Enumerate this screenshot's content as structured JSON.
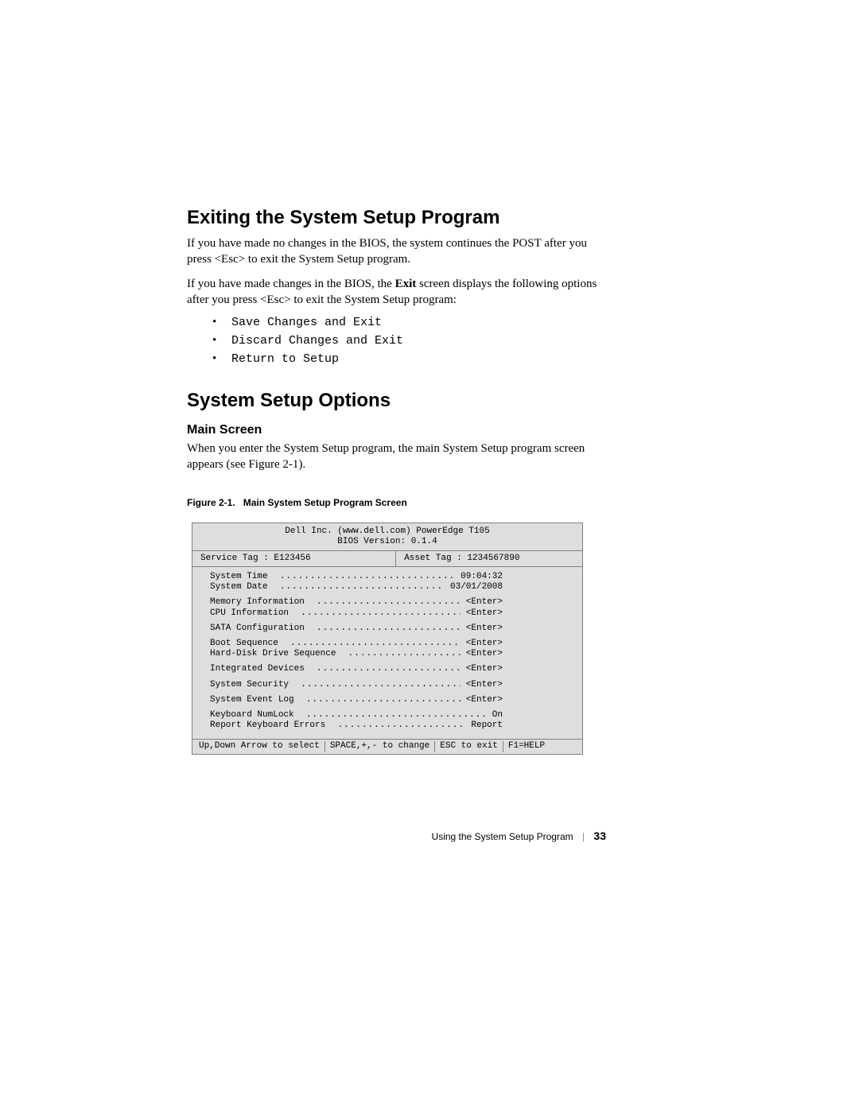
{
  "headings": {
    "exiting": "Exiting the System Setup Program",
    "options": "System Setup Options",
    "main_screen": "Main Screen"
  },
  "paragraphs": {
    "p1": "If you have made no changes in the BIOS, the system continues the POST after you press <Esc> to exit the System Setup program.",
    "p2a": "If you have made changes in the BIOS, the ",
    "p2b": "Exit",
    "p2c": " screen displays the following options after you press <Esc> to exit the System Setup program:",
    "p3": "When you enter the System Setup program, the main System Setup program screen appears (see Figure 2-1)."
  },
  "exit_options": [
    "Save Changes and Exit",
    "Discard Changes and Exit",
    "Return to Setup"
  ],
  "figure_caption": {
    "label": "Figure 2-1.",
    "title": "Main System Setup Program Screen"
  },
  "bios": {
    "header_line1": "Dell Inc. (www.dell.com) PowerEdge T105",
    "header_line2": "BIOS Version: 0.1.4",
    "service_tag_label": "Service Tag : ",
    "service_tag_value": "E123456",
    "asset_tag_label": "Asset Tag : ",
    "asset_tag_value": "1234567890",
    "rows": [
      {
        "label": "System Time",
        "value": "09:04:32",
        "blank_after": false
      },
      {
        "label": "System Date",
        "value": "03/01/2008",
        "blank_after": true
      },
      {
        "label": "Memory Information",
        "value": "<Enter>",
        "blank_after": false
      },
      {
        "label": "CPU Information",
        "value": "<Enter>",
        "blank_after": true
      },
      {
        "label": "SATA Configuration",
        "value": "<Enter>",
        "blank_after": true
      },
      {
        "label": "Boot Sequence",
        "value": "<Enter>",
        "blank_after": false
      },
      {
        "label": "Hard-Disk Drive Sequence",
        "value": "<Enter>",
        "blank_after": true
      },
      {
        "label": "Integrated Devices",
        "value": "<Enter>",
        "blank_after": true
      },
      {
        "label": "System Security",
        "value": "<Enter>",
        "blank_after": true
      },
      {
        "label": "System Event Log",
        "value": "<Enter>",
        "blank_after": true
      },
      {
        "label": "Keyboard NumLock",
        "value": "On",
        "blank_after": false
      },
      {
        "label": "Report Keyboard Errors",
        "value": "Report",
        "blank_after": false
      }
    ],
    "footer": [
      "Up,Down Arrow to select",
      "SPACE,+,- to change",
      "ESC to exit",
      "F1=HELP"
    ]
  },
  "page_footer": {
    "title": "Using the System Setup Program",
    "page_number": "33"
  },
  "dots": ".............................................................."
}
